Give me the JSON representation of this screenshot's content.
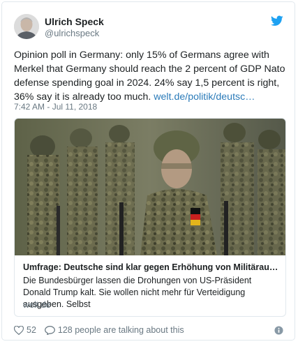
{
  "author": {
    "name": "Ulrich Speck",
    "handle": "@ulrichspeck"
  },
  "tweet": {
    "text": "Opinion poll in Germany: only 15% of Germans agree with Merkel that Germany should reach the 2 percent of GDP Nato defense spending goal in 2024. 24% say 1,5 percent is right, 36% say it is already too much. ",
    "link": "welt.de/politik/deutsc…",
    "timestamp": "7:42 AM - Jul 11, 2018"
  },
  "card": {
    "title": "Umfrage: Deutsche sind klar gegen Erhöhung von Militäraus…",
    "description": "Die Bundesbürger lassen die Drohungen von US-Präsident Donald Trump kalt. Sie wollen nicht mehr für Verteidigung ausgeben. Selbst",
    "domain": "welt.de"
  },
  "actions": {
    "likes": "52",
    "replies": "128 people are talking about this"
  },
  "icons": {
    "brand": "twitter-bird-icon",
    "like": "heart-icon",
    "reply": "speech-bubble-icon",
    "info": "info-icon"
  },
  "colors": {
    "brand": "#1da1f2",
    "link": "#2b7bb9",
    "muted": "#697882",
    "border": "#e1e8ed"
  }
}
